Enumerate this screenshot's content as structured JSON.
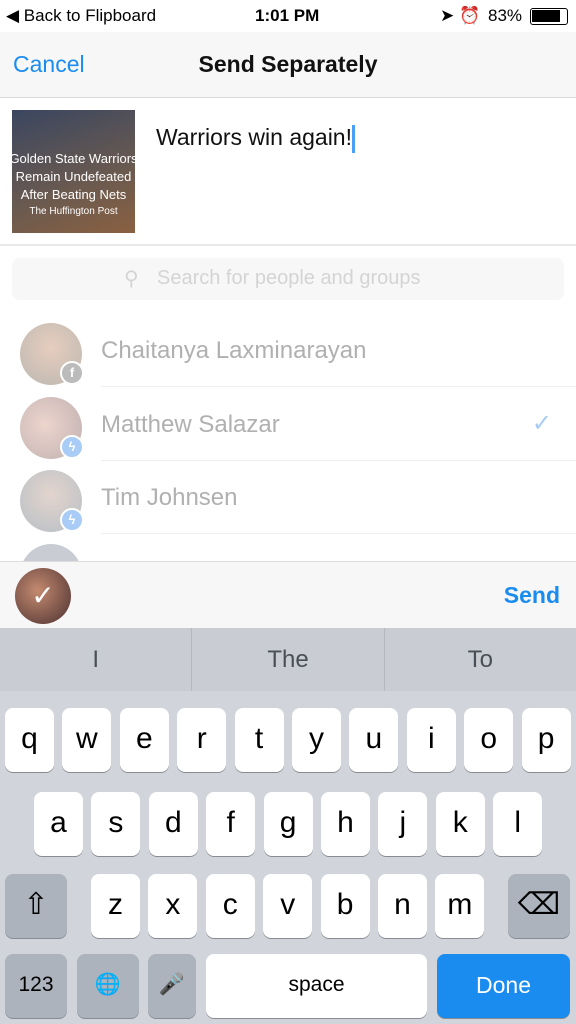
{
  "status": {
    "back": "◀ Back to Flipboard",
    "time": "1:01 PM",
    "battery": "83%"
  },
  "nav": {
    "cancel": "Cancel",
    "title": "Send Separately"
  },
  "article": {
    "headline": "Golden State Warriors Remain Undefeated After Beating Nets",
    "source": "The Huffington Post"
  },
  "message": "Warriors win again!",
  "search": {
    "placeholder": "Search for people and groups"
  },
  "contacts": [
    {
      "name": "Chaitanya Laxminarayan",
      "source": "facebook",
      "selected": false
    },
    {
      "name": "Matthew Salazar",
      "source": "messenger",
      "selected": true
    },
    {
      "name": "Tim Johnsen",
      "source": "messenger",
      "selected": false
    }
  ],
  "send": "Send",
  "suggestions": [
    "I",
    "The",
    "To"
  ],
  "keys": {
    "row1": [
      "q",
      "w",
      "e",
      "r",
      "t",
      "y",
      "u",
      "i",
      "o",
      "p"
    ],
    "row2": [
      "a",
      "s",
      "d",
      "f",
      "g",
      "h",
      "j",
      "k",
      "l"
    ],
    "row3": [
      "z",
      "x",
      "c",
      "v",
      "b",
      "n",
      "m"
    ],
    "shift": "⇧",
    "delete": "⌫",
    "numbers": "123",
    "globe": "🌐",
    "mic": "🎤",
    "space": "space",
    "done": "Done"
  },
  "colors": {
    "accent": "#1a8cf0"
  }
}
